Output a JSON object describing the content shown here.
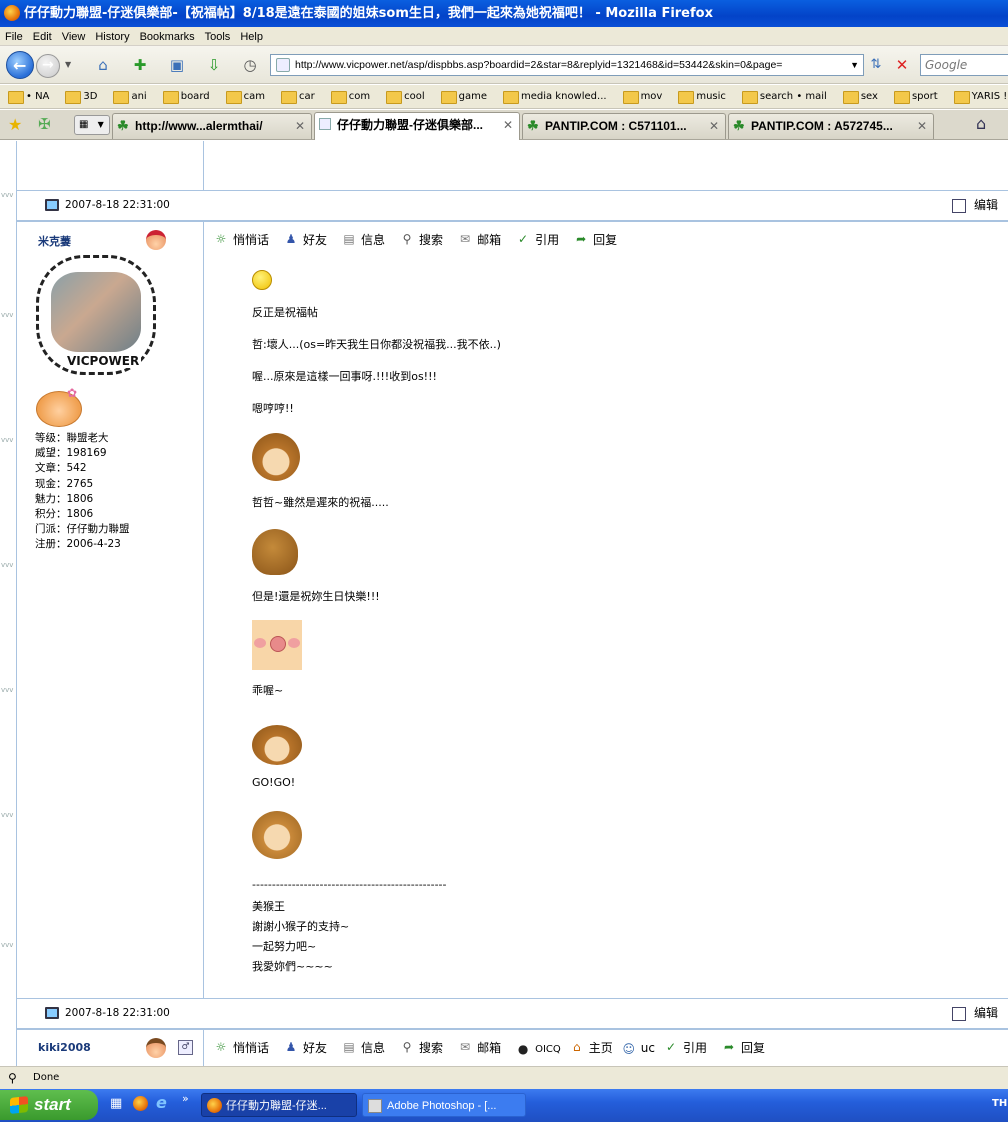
{
  "window": {
    "title": "仔仔動力聯盟-仔迷俱樂部-【祝福帖】8/18是遠在泰國的姐妹som生日，我們一起來為她祝福吧！ - Mozilla Firefox"
  },
  "menu": [
    "File",
    "Edit",
    "View",
    "History",
    "Bookmarks",
    "Tools",
    "Help"
  ],
  "nav": {
    "url": "http://www.vicpower.net/asp/dispbbs.asp?boardid=2&star=8&replyid=1321468&id=53442&skin=0&page=",
    "search_placeholder": "Google"
  },
  "bookmarks": [
    "• NA",
    "3D",
    "ani",
    "board",
    "cam",
    "car",
    "com",
    "cool",
    "game",
    "media knowled...",
    "mov",
    "music",
    "search • mail",
    "sex",
    "sport",
    "YARIS !"
  ],
  "tabs": [
    {
      "label": "http://www...alermthai/",
      "active": false
    },
    {
      "label": "仔仔動力聯盟-仔迷俱樂部...",
      "active": true
    },
    {
      "label": "PANTIP.COM : C571101...",
      "active": false
    },
    {
      "label": "PANTIP.COM : A572745...",
      "active": false
    }
  ],
  "post1": {
    "datetime": "2007-8-18 22:31:00",
    "edit_label": "编辑",
    "user": {
      "name": "米克萋",
      "avatar_text": "VICPOWER",
      "stats": [
        {
          "label": "等级",
          "value": "聯盟老大"
        },
        {
          "label": "威望",
          "value": "198169"
        },
        {
          "label": "文章",
          "value": "542"
        },
        {
          "label": "现金",
          "value": "2765"
        },
        {
          "label": "魅力",
          "value": "1806"
        },
        {
          "label": "积分",
          "value": "1806"
        },
        {
          "label": "门派",
          "value": "仔仔動力聯盟"
        },
        {
          "label": "注册",
          "value": "2006-4-23"
        }
      ]
    },
    "actions": [
      "悄悄话",
      "好友",
      "信息",
      "搜索",
      "邮箱",
      "引用",
      "回复"
    ],
    "lines": [
      "反正是祝福帖",
      "哲:壞人...(os=昨天我生日你都没祝福我...我不依..)",
      "喔...原來是這樣一回事呀.!!!收到os!!!",
      "嗯哼哼!!",
      "哲哲~雖然是遲來的祝福.....",
      "但是!還是祝妳生日快樂!!!",
      "乖喔~",
      "GO!GO!",
      "-------------------------------------------------",
      "美猴王",
      "謝謝小猴子的支持~",
      "一起努力吧~",
      "我愛妳們~~~~"
    ]
  },
  "post2": {
    "datetime": "2007-8-18 22:31:00",
    "edit_label": "编辑",
    "user": {
      "name": "kiki2008"
    },
    "actions": [
      "悄悄话",
      "好友",
      "信息",
      "搜索",
      "邮箱",
      "OICQ",
      "主页",
      "uc",
      "引用",
      "回复"
    ]
  },
  "status": {
    "text": "Done"
  },
  "taskbar": {
    "start": "start",
    "tasks": [
      "仔仔動力聯盟-仔迷...",
      "Adobe Photoshop - [..."
    ],
    "tray": "TH"
  }
}
